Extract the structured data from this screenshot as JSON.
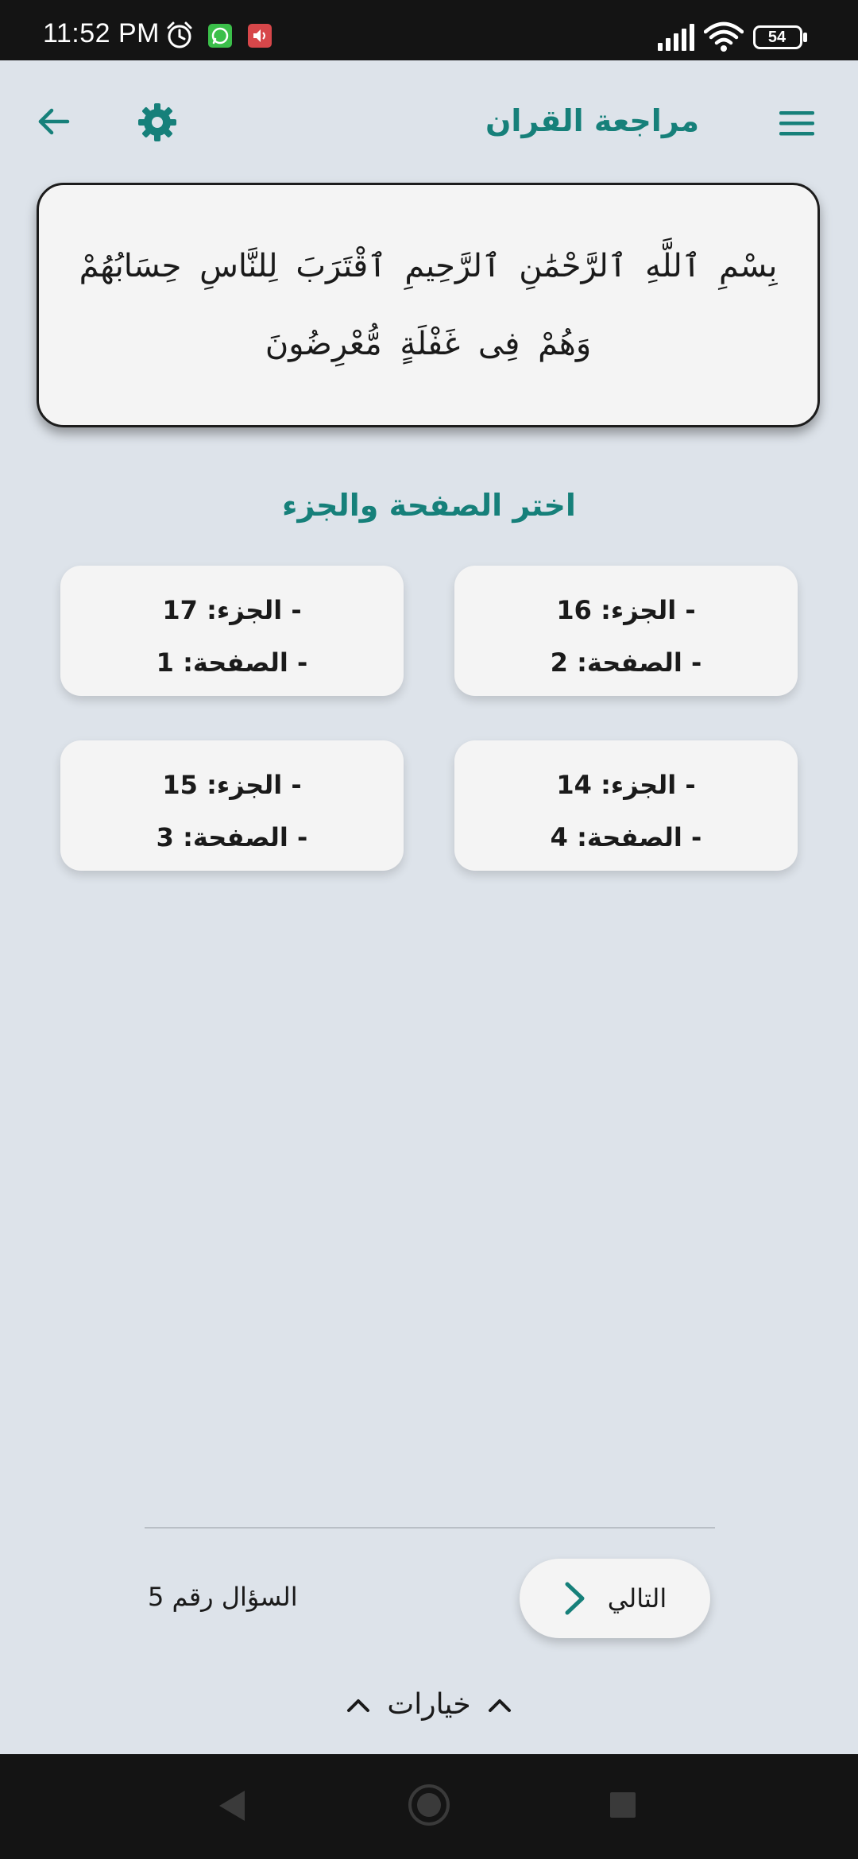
{
  "status_bar": {
    "time": "11:52 PM",
    "battery": "54",
    "icons": [
      "alarm-icon",
      "whatsapp-icon",
      "sound-icon",
      "signal-icon",
      "wifi-icon",
      "battery-icon"
    ]
  },
  "header": {
    "title": "مراجعة القران",
    "menu_icon": "hamburger-menu-icon",
    "settings_icon": "gear-icon",
    "back_icon": "arrow-left-icon"
  },
  "verse": {
    "text": "بِسْمِ ٱللَّهِ ٱلرَّحْمَٰنِ ٱلرَّحِيمِ ٱقْتَرَبَ لِلنَّاسِ حِسَابُهُمْ وَهُمْ فِى غَفْلَةٍ مُّعْرِضُونَ"
  },
  "prompt": "اختر الصفحة والجزء",
  "options": [
    {
      "juz_line": "- الجزء: 16",
      "page_line": "- الصفحة: 2"
    },
    {
      "juz_line": "- الجزء: 17",
      "page_line": "- الصفحة: 1"
    },
    {
      "juz_line": "- الجزء: 14",
      "page_line": "- الصفحة: 4"
    },
    {
      "juz_line": "- الجزء: 15",
      "page_line": "- الصفحة: 3"
    }
  ],
  "footer": {
    "question_number": "السؤال رقم 5",
    "next_label": "التالي",
    "options_label": "خيارات"
  },
  "colors": {
    "accent": "#16807a",
    "background": "#dde3ea",
    "card": "#f4f4f4",
    "status_bar": "#141414"
  }
}
